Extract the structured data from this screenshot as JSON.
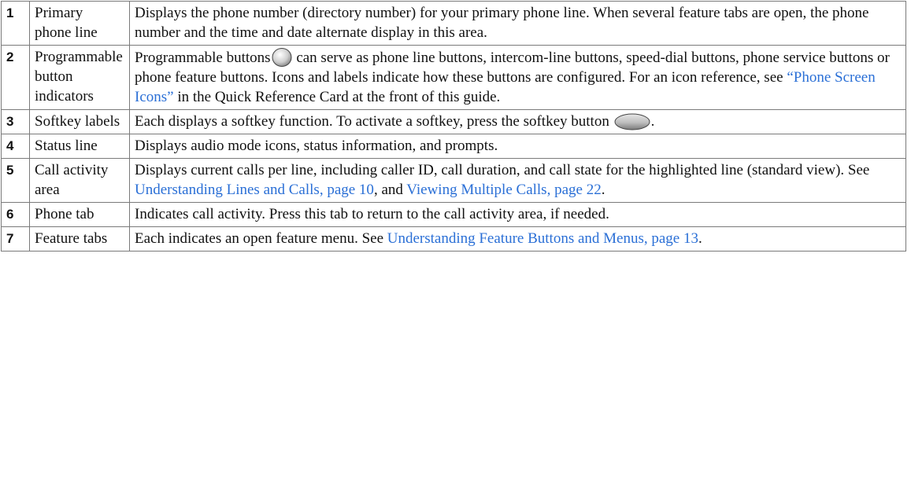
{
  "rows": [
    {
      "num": "1",
      "name": "Primary phone line",
      "desc": "Displays the phone number (directory number) for your primary phone line. When several feature tabs are open, the phone number and the time and date alternate display in this area."
    },
    {
      "num": "2",
      "name": "Programmable button indicators",
      "desc_a": "Programmable buttons",
      "desc_b": " can serve as phone line buttons, intercom-line buttons, speed-dial buttons, phone service buttons or phone feature buttons. Icons and labels indicate how these buttons are configured. For an icon reference, see ",
      "link": "“Phone Screen Icons”",
      "desc_c": " in the Quick Reference Card at the front of this guide.",
      "icon": "round-button-icon"
    },
    {
      "num": "3",
      "name": "Softkey labels",
      "desc_a": "Each displays a softkey function. To activate a softkey, press the softkey button",
      "desc_b": ".",
      "icon": "softkey-button-icon"
    },
    {
      "num": "4",
      "name": "Status line",
      "desc": "Displays audio mode icons, status information, and prompts."
    },
    {
      "num": "5",
      "name": "Call activity area",
      "desc_a": "Displays current calls per line, including caller ID, call duration, and call state for the highlighted line (standard view). See ",
      "link1": "Understanding Lines and Calls, page 10",
      "desc_b": ", and ",
      "link2": "Viewing Multiple Calls, page 22",
      "desc_c": "."
    },
    {
      "num": "6",
      "name": "Phone tab",
      "desc": "Indicates call activity. Press this tab to return to the call activity area, if needed."
    },
    {
      "num": "7",
      "name": "Feature tabs",
      "desc_a": "Each indicates an open feature menu. See ",
      "link": "Understanding Feature Buttons and Menus, page 13",
      "desc_b": "."
    }
  ],
  "colors": {
    "link": "#2a6fd6",
    "border": "#7a7a7a"
  }
}
